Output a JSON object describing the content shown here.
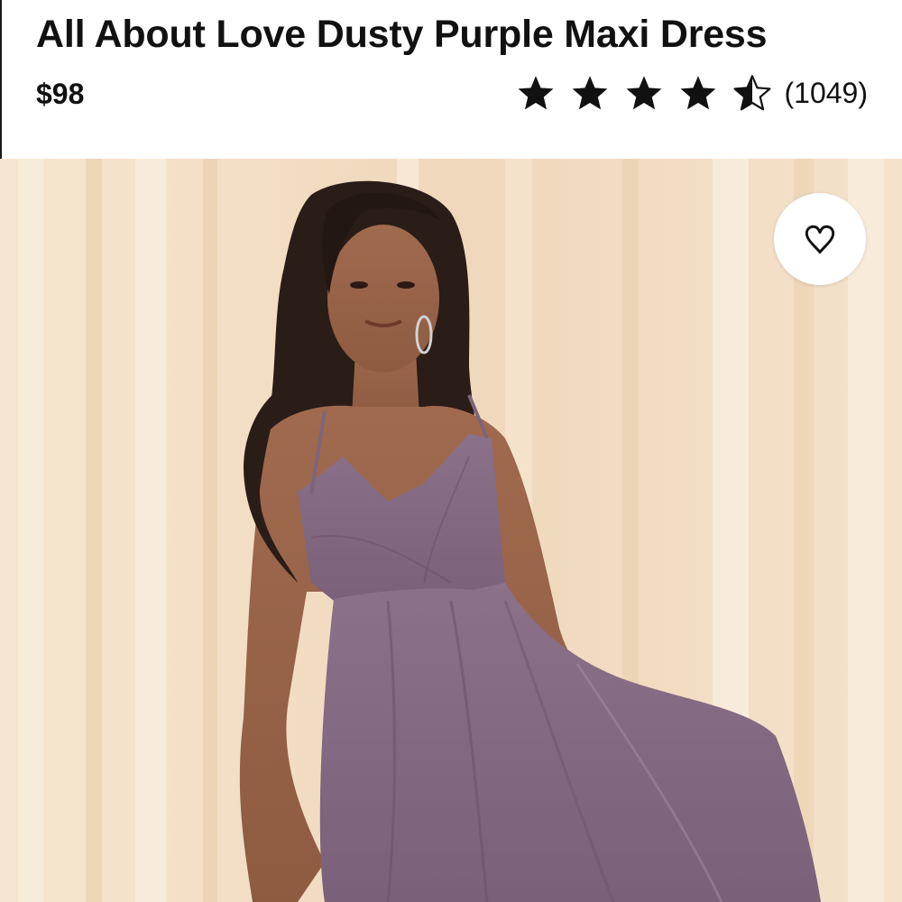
{
  "product": {
    "title": "All About Love Dusty Purple Maxi Dress",
    "price": "$98",
    "rating": {
      "value": 4.5,
      "max": 5,
      "count_label": "(1049)"
    }
  },
  "image": {
    "alt": "Model wearing dusty purple maxi dress in front of sheer curtains",
    "favorite_icon": "heart-icon"
  },
  "colors": {
    "dress": "#8a6f85",
    "background": "#f0dcc1",
    "star": "#111111"
  }
}
